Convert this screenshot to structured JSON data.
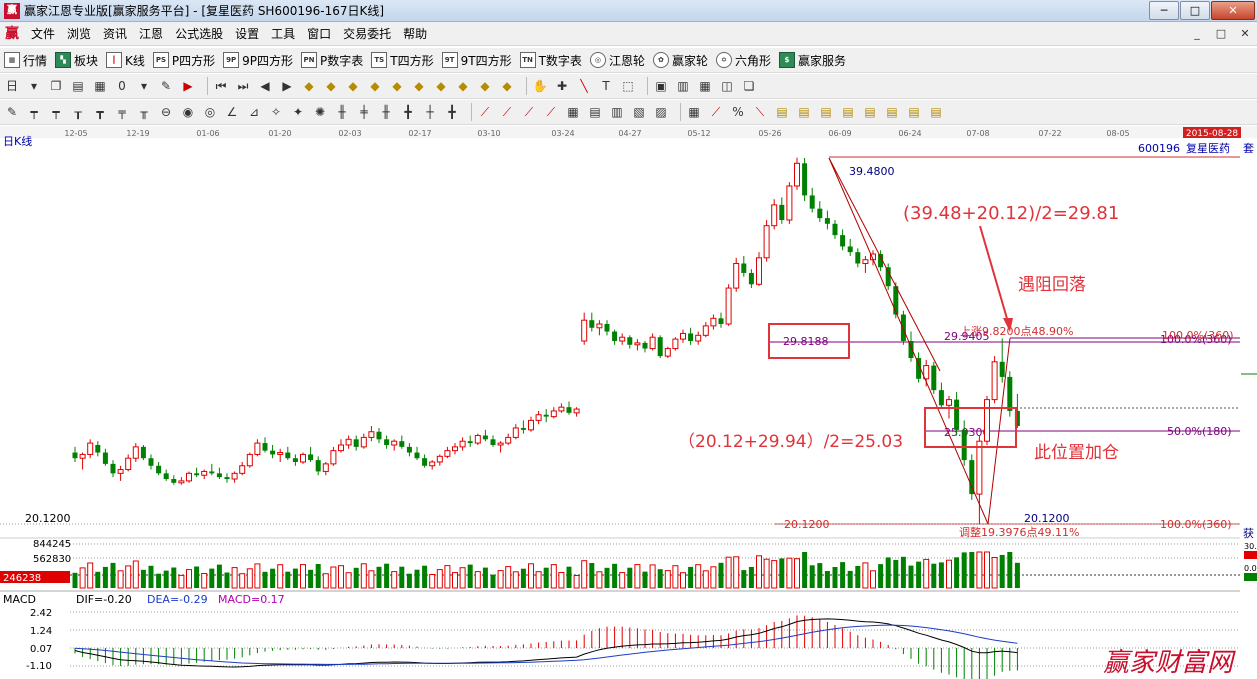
{
  "window": {
    "title": "赢家江恩专业版[赢家服务平台] - [复星医药  SH600196-167日K线]",
    "logo_text": "赢",
    "controls": [
      "─",
      "□",
      "✕"
    ]
  },
  "menu": {
    "logo_text": "赢",
    "items": [
      "文件",
      "浏览",
      "资讯",
      "江恩",
      "公式选股",
      "设置",
      "工具",
      "窗口",
      "交易委托",
      "帮助"
    ],
    "mdi_controls": [
      "_",
      "□",
      "✕"
    ]
  },
  "toolbar1": {
    "items": [
      {
        "icon": "grid-icon",
        "glyph": "▦",
        "label": "行情"
      },
      {
        "icon": "blocks-icon",
        "glyph": "▚",
        "label": "板块"
      },
      {
        "icon": "kline-icon",
        "glyph": "┃",
        "label": "K线"
      },
      {
        "icon": "p-square-icon",
        "glyph": "PS",
        "label": "P四方形"
      },
      {
        "icon": "9p-square-icon",
        "glyph": "9P",
        "label": "9P四方形"
      },
      {
        "icon": "pn-table-icon",
        "glyph": "PN",
        "label": "P数字表"
      },
      {
        "icon": "ts-square-icon",
        "glyph": "TS",
        "label": "T四方形"
      },
      {
        "icon": "9t-square-icon",
        "glyph": "9T",
        "label": "9T四方形"
      },
      {
        "icon": "tn-table-icon",
        "glyph": "TN",
        "label": "T数字表"
      },
      {
        "icon": "gann-wheel-icon",
        "glyph": "◎",
        "label": "江恩轮"
      },
      {
        "icon": "winner-wheel-icon",
        "glyph": "✿",
        "label": "赢家轮"
      },
      {
        "icon": "hexagon-icon",
        "glyph": "✡",
        "label": "六角形"
      },
      {
        "icon": "dollar-icon",
        "glyph": "$",
        "label": "赢家服务"
      }
    ]
  },
  "toolbar2": {
    "icons": [
      "period-day-icon",
      "chevron-down-icon",
      "copy-icon",
      "page-icon",
      "calc-icon",
      "zero-icon",
      "chevron-down-icon",
      "tool-icon",
      "flag-icon",
      "first-icon",
      "last-icon",
      "prev-icon",
      "next-icon",
      "diamond-icon",
      "diamond-icon",
      "diamond-icon",
      "diamond-icon",
      "diamond-icon",
      "diamond-icon",
      "diamond-icon",
      "diamond-icon",
      "diamond-icon",
      "diamond-icon",
      "hand-icon",
      "cross-icon",
      "line-icon",
      "text-icon",
      "select-icon",
      "calendar-icon",
      "cell-icon",
      "film-icon",
      "cube-icon",
      "layers-icon"
    ],
    "period_label": "日"
  },
  "toolbar3": {
    "icons": [
      "pen-icon",
      "bars-icon",
      "bars-icon",
      "bars-icon",
      "bars-icon",
      "bars-icon",
      "bars-icon",
      "circle-icon",
      "circle-icon",
      "circle-icon",
      "angle-icon",
      "angle-icon",
      "star-icon",
      "star-icon",
      "star-icon",
      "bars-icon",
      "bars-icon",
      "bars-icon",
      "bars-icon",
      "bars-icon",
      "bars-icon",
      "fan-icon",
      "fan-icon",
      "fan-icon",
      "fan-icon",
      "grid-icon",
      "grid-icon",
      "grid-icon",
      "grid-icon",
      "grid-icon",
      "percent-icon",
      "percent-icon",
      "grid-icon",
      "grid-icon",
      "grid-icon",
      "grid-icon",
      "grid-icon",
      "grid-icon",
      "grid-icon",
      "grid-icon"
    ],
    "percent_label": "%"
  },
  "chart": {
    "period_label": "日K线",
    "date_ticks": [
      "12-05",
      "12-19",
      "01-06",
      "01-20",
      "02-03",
      "02-17",
      "03-10",
      "03-24",
      "04-27",
      "05-12",
      "05-26",
      "06-09",
      "06-24",
      "07-08",
      "07-22",
      "08-05",
      "08-19"
    ],
    "date_badge": "2015-08-28",
    "stock_code": "600196",
    "stock_name": "复星医药",
    "stock_name_trunc": "套",
    "price_low_label": "20.1200",
    "high_label": "39.4800",
    "low_label": "20.1200",
    "mid_label_left": "29.8188",
    "mid_label_right": "29.9405",
    "half_label": "25.0300",
    "rise_label": "上涨9.8200点48.90%",
    "drop_label": "调整19.3976点49.11%",
    "pct_100_top": "100.0%(360)",
    "pct_50": "50.0%(180)",
    "pct_100_bottom": "100.0%(360)",
    "side_label": "获",
    "side_v1": "30.",
    "side_v2": "0.0",
    "annotation_top_formula": "(39.48+20.12)/2=29.81",
    "annotation_resist": "遇阻回落",
    "annotation_mid_formula": "（20.12+29.94）/2=25.03",
    "annotation_add": "此位置加仓"
  },
  "volume": {
    "labels": [
      "844245",
      "562830",
      "246238"
    ]
  },
  "macd": {
    "name": "MACD",
    "dif": "DIF=-0.20",
    "dea": "DEA=-0.29",
    "macd_val": "MACD=0.17",
    "axis": [
      "2.42",
      "1.24",
      "0.07",
      "-1.10"
    ]
  },
  "watermark": "赢家财富网",
  "colors": {
    "up": "#e00000",
    "down": "#008000",
    "purple": "#800080",
    "annotation": "#e0333a",
    "macd_dif": "#000000",
    "macd_dea": "#1c3cc8"
  },
  "chart_data": {
    "type": "candlestick",
    "ylim": [
      18.5,
      40.5
    ],
    "candles": [
      [
        23.9,
        24.2,
        23.4,
        23.6
      ],
      [
        23.6,
        23.9,
        23.0,
        23.8
      ],
      [
        23.8,
        24.6,
        23.6,
        24.4
      ],
      [
        24.3,
        24.5,
        23.7,
        23.9
      ],
      [
        23.9,
        24.1,
        23.2,
        23.3
      ],
      [
        23.3,
        23.5,
        22.6,
        22.8
      ],
      [
        22.8,
        23.2,
        22.4,
        23.0
      ],
      [
        23.0,
        23.8,
        22.9,
        23.6
      ],
      [
        23.6,
        24.4,
        23.4,
        24.2
      ],
      [
        24.2,
        24.3,
        23.5,
        23.6
      ],
      [
        23.6,
        23.8,
        23.0,
        23.2
      ],
      [
        23.2,
        23.4,
        22.7,
        22.8
      ],
      [
        22.8,
        23.0,
        22.4,
        22.5
      ],
      [
        22.5,
        22.7,
        22.2,
        22.3
      ],
      [
        22.3,
        22.6,
        22.2,
        22.4
      ],
      [
        22.4,
        22.9,
        22.3,
        22.8
      ],
      [
        22.8,
        23.1,
        22.6,
        22.7
      ],
      [
        22.7,
        23.0,
        22.5,
        22.9
      ],
      [
        22.9,
        23.3,
        22.7,
        22.8
      ],
      [
        22.8,
        23.1,
        22.5,
        22.6
      ],
      [
        22.6,
        22.8,
        22.3,
        22.5
      ],
      [
        22.5,
        22.9,
        22.3,
        22.8
      ],
      [
        22.8,
        23.4,
        22.7,
        23.2
      ],
      [
        23.2,
        23.9,
        23.1,
        23.8
      ],
      [
        23.8,
        24.6,
        23.7,
        24.4
      ],
      [
        24.4,
        24.7,
        23.9,
        24.0
      ],
      [
        24.0,
        24.3,
        23.6,
        23.8
      ],
      [
        23.8,
        24.1,
        23.4,
        23.9
      ],
      [
        23.9,
        24.2,
        23.5,
        23.6
      ],
      [
        23.6,
        23.8,
        23.2,
        23.4
      ],
      [
        23.4,
        23.9,
        23.3,
        23.8
      ],
      [
        23.8,
        24.2,
        23.4,
        23.5
      ],
      [
        23.5,
        23.7,
        22.7,
        22.9
      ],
      [
        22.9,
        23.4,
        22.7,
        23.3
      ],
      [
        23.3,
        24.2,
        23.2,
        24.0
      ],
      [
        24.0,
        24.6,
        23.9,
        24.3
      ],
      [
        24.3,
        24.8,
        24.1,
        24.6
      ],
      [
        24.6,
        24.8,
        24.0,
        24.2
      ],
      [
        24.2,
        24.9,
        24.1,
        24.7
      ],
      [
        24.7,
        25.3,
        24.5,
        25.0
      ],
      [
        25.0,
        25.2,
        24.4,
        24.6
      ],
      [
        24.6,
        24.8,
        24.1,
        24.3
      ],
      [
        24.3,
        24.6,
        24.0,
        24.5
      ],
      [
        24.5,
        24.8,
        24.1,
        24.2
      ],
      [
        24.2,
        24.4,
        23.7,
        23.9
      ],
      [
        23.9,
        24.2,
        23.5,
        23.6
      ],
      [
        23.6,
        23.8,
        23.1,
        23.2
      ],
      [
        23.2,
        23.5,
        23.0,
        23.4
      ],
      [
        23.4,
        23.8,
        23.2,
        23.7
      ],
      [
        23.7,
        24.2,
        23.6,
        24.0
      ],
      [
        24.0,
        24.4,
        23.8,
        24.2
      ],
      [
        24.2,
        24.7,
        24.0,
        24.5
      ],
      [
        24.5,
        24.8,
        24.2,
        24.4
      ],
      [
        24.4,
        24.9,
        24.3,
        24.8
      ],
      [
        24.8,
        25.1,
        24.5,
        24.6
      ],
      [
        24.6,
        24.8,
        24.2,
        24.3
      ],
      [
        24.3,
        24.5,
        23.9,
        24.4
      ],
      [
        24.4,
        24.9,
        24.3,
        24.7
      ],
      [
        24.7,
        25.4,
        24.6,
        25.2
      ],
      [
        25.2,
        25.6,
        24.9,
        25.1
      ],
      [
        25.1,
        25.8,
        25.0,
        25.6
      ],
      [
        25.6,
        26.1,
        25.4,
        25.9
      ],
      [
        25.9,
        26.2,
        25.5,
        25.8
      ],
      [
        25.8,
        26.3,
        25.7,
        26.1
      ],
      [
        26.1,
        26.5,
        26.0,
        26.3
      ],
      [
        26.3,
        26.6,
        25.9,
        26.0
      ],
      [
        26.0,
        26.3,
        25.8,
        26.2
      ],
      [
        29.8,
        31.3,
        29.6,
        30.9
      ],
      [
        30.9,
        31.3,
        30.3,
        30.5
      ],
      [
        30.5,
        30.9,
        30.1,
        30.7
      ],
      [
        30.7,
        30.9,
        30.1,
        30.3
      ],
      [
        30.3,
        30.4,
        29.6,
        29.8
      ],
      [
        29.8,
        30.2,
        29.6,
        30.0
      ],
      [
        30.0,
        30.1,
        29.4,
        29.6
      ],
      [
        29.6,
        29.9,
        29.3,
        29.7
      ],
      [
        29.7,
        29.8,
        29.2,
        29.4
      ],
      [
        29.4,
        30.2,
        29.3,
        30.0
      ],
      [
        30.0,
        30.1,
        28.9,
        29.0
      ],
      [
        29.0,
        29.5,
        28.9,
        29.4
      ],
      [
        29.4,
        30.0,
        29.3,
        29.9
      ],
      [
        29.9,
        30.4,
        29.7,
        30.2
      ],
      [
        30.2,
        30.5,
        29.6,
        29.8
      ],
      [
        29.8,
        30.3,
        29.6,
        30.1
      ],
      [
        30.1,
        30.8,
        30.0,
        30.6
      ],
      [
        30.6,
        31.2,
        30.4,
        31.0
      ],
      [
        31.0,
        31.3,
        30.5,
        30.7
      ],
      [
        30.7,
        32.8,
        30.6,
        32.6
      ],
      [
        32.6,
        34.2,
        32.4,
        33.9
      ],
      [
        33.9,
        34.3,
        33.2,
        33.4
      ],
      [
        33.4,
        33.6,
        32.6,
        32.8
      ],
      [
        32.8,
        34.5,
        32.7,
        34.2
      ],
      [
        34.2,
        36.2,
        34.0,
        35.9
      ],
      [
        35.9,
        37.3,
        35.7,
        37.0
      ],
      [
        37.0,
        37.4,
        36.0,
        36.2
      ],
      [
        36.2,
        38.2,
        36.0,
        38.0
      ],
      [
        38.0,
        39.5,
        37.8,
        39.2
      ],
      [
        39.2,
        39.48,
        37.2,
        37.5
      ],
      [
        37.5,
        37.9,
        36.6,
        36.8
      ],
      [
        36.8,
        37.2,
        36.1,
        36.3
      ],
      [
        36.3,
        36.7,
        35.7,
        36.0
      ],
      [
        36.0,
        36.2,
        35.2,
        35.4
      ],
      [
        35.4,
        35.7,
        34.6,
        34.8
      ],
      [
        34.8,
        35.2,
        34.3,
        34.5
      ],
      [
        34.5,
        34.7,
        33.7,
        33.9
      ],
      [
        33.9,
        34.3,
        33.4,
        34.1
      ],
      [
        34.1,
        34.6,
        33.8,
        34.4
      ],
      [
        34.4,
        34.6,
        33.5,
        33.7
      ],
      [
        33.7,
        33.9,
        32.5,
        32.7
      ],
      [
        32.7,
        32.9,
        31.0,
        31.2
      ],
      [
        31.2,
        31.4,
        29.6,
        29.8
      ],
      [
        29.8,
        30.3,
        28.7,
        28.9
      ],
      [
        28.9,
        29.2,
        27.6,
        27.8
      ],
      [
        27.8,
        28.8,
        27.4,
        28.5
      ],
      [
        28.5,
        28.7,
        27.0,
        27.2
      ],
      [
        27.2,
        27.6,
        26.2,
        26.4
      ],
      [
        26.4,
        26.9,
        25.7,
        26.7
      ],
      [
        26.7,
        27.1,
        24.8,
        25.1
      ],
      [
        25.1,
        25.6,
        23.2,
        23.5
      ],
      [
        23.5,
        23.8,
        21.4,
        21.7
      ],
      [
        21.7,
        24.8,
        20.12,
        24.5
      ],
      [
        24.5,
        26.9,
        24.3,
        26.7
      ],
      [
        26.7,
        29.0,
        26.5,
        28.7
      ],
      [
        28.7,
        29.94,
        27.6,
        27.9
      ],
      [
        27.9,
        28.2,
        25.8,
        26.1
      ],
      [
        26.1,
        27.0,
        25.2,
        25.3
      ]
    ],
    "price_levels": {
      "high": 39.48,
      "low": 20.12,
      "mid": 29.81,
      "half": 25.03
    },
    "volume_labels": [
      844245,
      562830,
      246238
    ],
    "macd": {
      "dif": -0.2,
      "dea": -0.29,
      "macd": 0.17,
      "axis": [
        2.42,
        1.24,
        0.07,
        -1.1
      ]
    }
  }
}
